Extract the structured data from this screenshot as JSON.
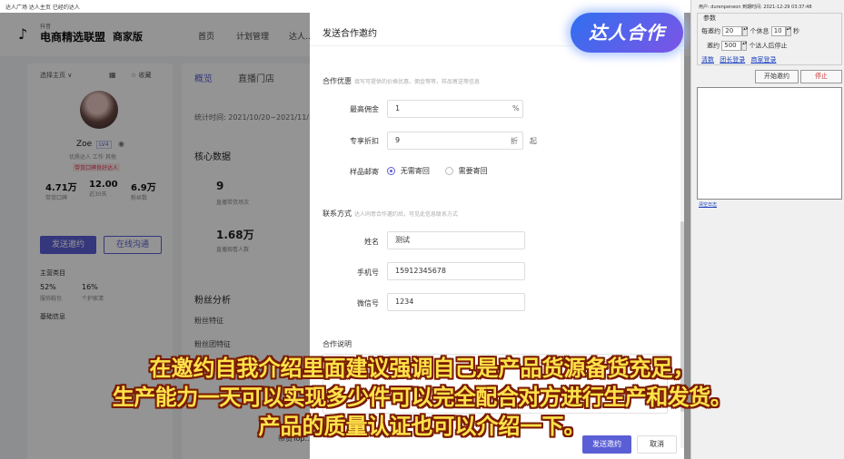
{
  "browser": {
    "tabs_text": "达人广场  达人主页  已经约达人"
  },
  "app": {
    "logo_icon": "tiktok-note-icon",
    "brand_small": "抖音",
    "brand_title": "电商精选联盟",
    "brand_edition": "商家版",
    "nav": [
      "首页",
      "计划管理",
      "达人..."
    ]
  },
  "profile": {
    "selector": "选择主页 ∨",
    "favorite": "☆ 收藏",
    "name": "Zoe",
    "level": "LV4",
    "tags": "优质达人  工作  其他",
    "note": "带货口碑良好达人",
    "stats": [
      {
        "value": "4.71万",
        "label": "带货口碑"
      },
      {
        "value": "12.00",
        "label": "近30天"
      },
      {
        "value": "6.9万",
        "label": "粉丝数"
      }
    ],
    "invite_label": "发送邀约",
    "chat_label": "在线沟通",
    "section1_title": "主营类目",
    "section1_values": [
      "52%",
      "16%"
    ],
    "section1_labels": [
      "服饰鞋包",
      "个护家清"
    ],
    "section2_title": "基础信息"
  },
  "middle": {
    "tabs": [
      "概览",
      "直播门店"
    ],
    "time_range": "统计时间: 2021/10/20~2021/11/...",
    "core_title": "核心数据",
    "core_value1": "9",
    "core_label1": "直播带货场次",
    "core_value2": "1.68万",
    "core_label2": "直播观看人数",
    "fans_title": "粉丝分析",
    "fans_row1": "粉丝特征",
    "fans_row2": "粉丝团特征",
    "bottom_label": "带货Top..."
  },
  "drawer": {
    "title": "发送合作邀约",
    "coop_section": "合作优惠",
    "coop_hint": "填写可提供的价格优惠、佣金等等，样品寄送等信息",
    "commission_label": "最高佣金",
    "commission_value": "1",
    "commission_suffix": "%",
    "discount_label": "专享折扣",
    "discount_value": "9",
    "discount_unit": "折",
    "discount_suffix": "起",
    "sample_label": "样品邮寄",
    "sample_options": [
      "无需寄回",
      "需要寄回"
    ],
    "sample_selected": 0,
    "contact_section": "联系方式",
    "contact_hint": "达人同意合作邀约后，可见此信息联系方式",
    "name_label": "姓名",
    "name_value": "测试",
    "phone_label": "手机号",
    "phone_value": "15912345678",
    "wechat_label": "微信号",
    "wechat_value": "1234",
    "desc_section": "合作说明",
    "submit_label": "发送邀约",
    "cancel_label": "取消"
  },
  "badge": {
    "text": "达人合作"
  },
  "tool": {
    "info": "用户: durenpeneon  到期时间: 2021-12-29 03:37:48",
    "group_title": "参数",
    "row1_label": "每邀约",
    "row1_value1": "20",
    "row1_mid": "个休息",
    "row1_value2": "10",
    "row1_unit": "秒",
    "row2_label": "邀约",
    "row2_value": "500",
    "row2_unit": "个达人后停止",
    "links": [
      "清数",
      "团长登录",
      "商家登录"
    ],
    "start_label": "开始邀约",
    "stop_label": "停止",
    "log_link": "清空日志"
  },
  "subtitles": [
    "在邀约自我介绍里面建议强调自己是产品货源备货充足，",
    "生产能力一天可以实现多少件可以完全配合对方进行生产和发货。",
    "产品的质量认证也可以介绍一下。"
  ]
}
